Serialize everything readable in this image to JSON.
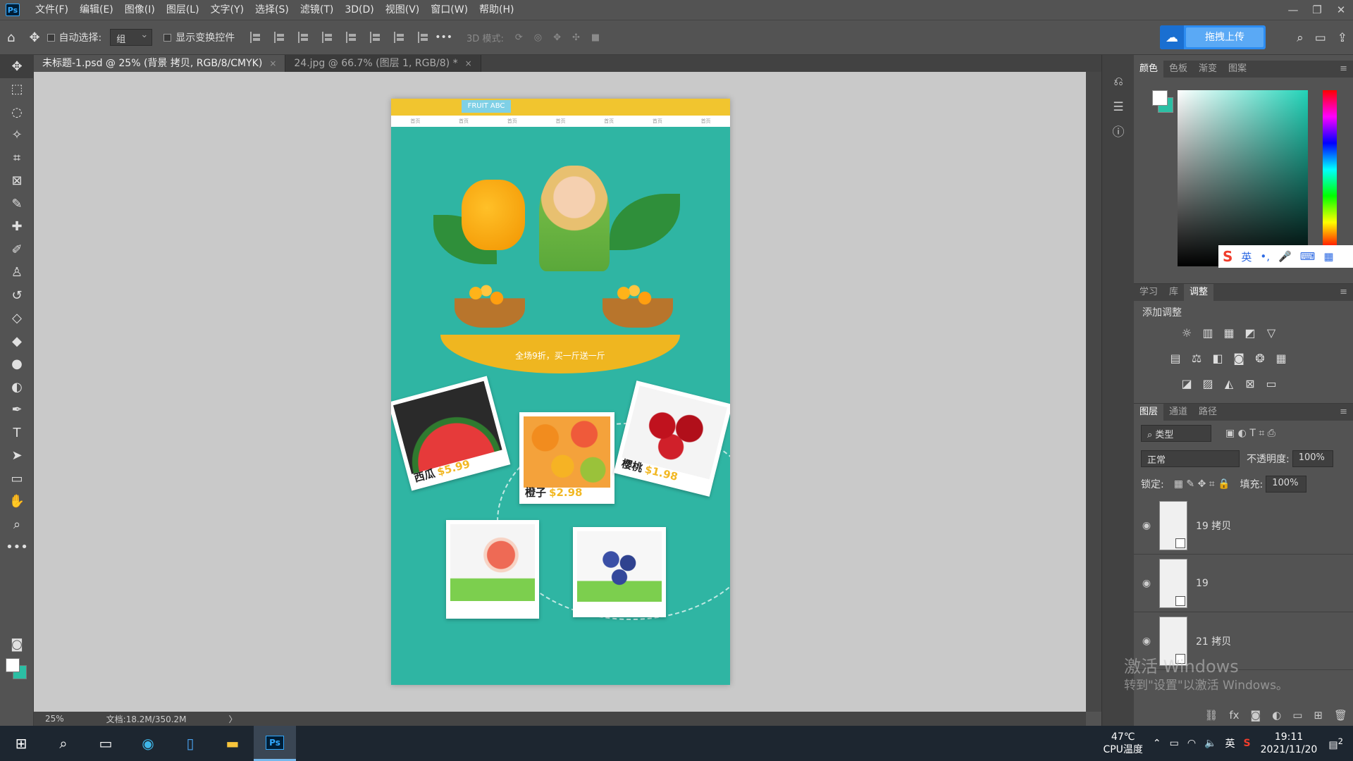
{
  "menubar": {
    "logo": "Ps",
    "items": [
      "文件(F)",
      "编辑(E)",
      "图像(I)",
      "图层(L)",
      "文字(Y)",
      "选择(S)",
      "滤镜(T)",
      "3D(D)",
      "视图(V)",
      "窗口(W)",
      "帮助(H)"
    ],
    "window_controls": [
      "—",
      "❐",
      "✕"
    ]
  },
  "options": {
    "auto_select_label": "自动选择:",
    "auto_select_value": "组",
    "show_transform_label": "显示变换控件",
    "mode_3d_label": "3D 模式:",
    "more": "•••",
    "upload_label": "拖拽上传"
  },
  "tabs": [
    {
      "label": "未标题-1.psd @ 25% (背景 拷贝, RGB/8/CMYK)",
      "close": "×"
    },
    {
      "label": "24.jpg @ 66.7% (图层 1, RGB/8) *",
      "close": "×"
    }
  ],
  "status": {
    "zoom": "25%",
    "doc": "文档:18.2M/350.2M",
    "arrow": "〉"
  },
  "artboard": {
    "logo_text": "FRUIT ABC",
    "nav": [
      "首页",
      "首页",
      "首页",
      "首页",
      "首页",
      "首页",
      "首页"
    ],
    "banner": "全场9折，买一斤送一斤",
    "cards": [
      {
        "name": "西瓜",
        "price": "$5.99"
      },
      {
        "name": "橙子",
        "price": "$2.98"
      },
      {
        "name": "樱桃",
        "price": "$1.98"
      }
    ]
  },
  "color_panel": {
    "tabs": [
      "颜色",
      "色板",
      "渐变",
      "图案"
    ],
    "fg": "#ffffff",
    "bg": "#2bbfa4"
  },
  "ime": {
    "items": [
      "S",
      "英",
      "•,",
      "🎤",
      "⌨",
      "▦"
    ]
  },
  "adjust_panel": {
    "tabs": [
      "学习",
      "库",
      "调整"
    ],
    "title": "添加调整"
  },
  "layers_panel": {
    "tabs": [
      "图层",
      "通道",
      "路径"
    ],
    "filter": "类型",
    "blend": "正常",
    "opacity_label": "不透明度:",
    "opacity_value": "100%",
    "lock_label": "锁定:",
    "fill_label": "填充:",
    "fill_value": "100%",
    "layers": [
      "19 拷贝",
      "19",
      "21 拷贝"
    ]
  },
  "watermark": {
    "line1": "激活 Windows",
    "line2": "转到\"设置\"以激活 Windows。"
  },
  "taskbar": {
    "temp": "47℃",
    "cpu_label": "CPU温度",
    "lang": "英",
    "time": "19:11",
    "date": "2021/11/20",
    "notif": "2"
  }
}
